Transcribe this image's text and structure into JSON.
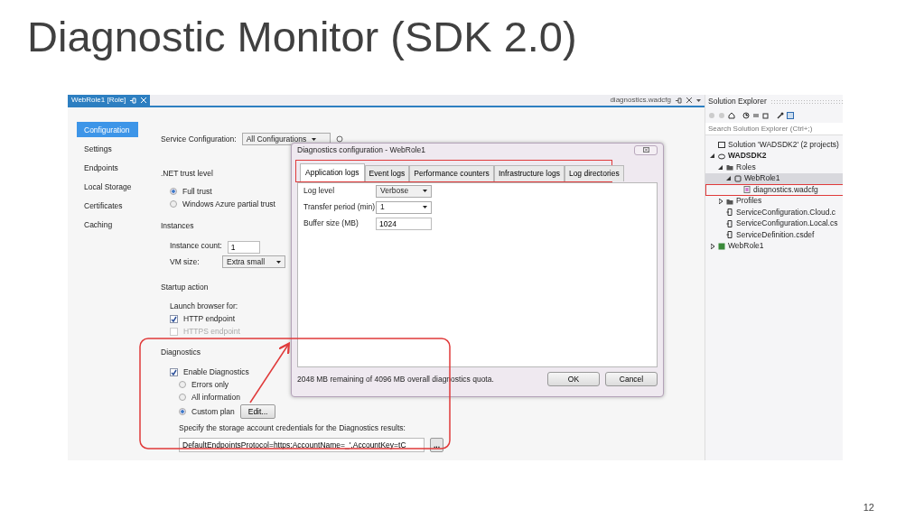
{
  "slide": {
    "title": "Diagnostic Monitor (SDK 2.0)",
    "page_number": "12"
  },
  "document_tabs": [
    {
      "label": "WebRole1 [Role]",
      "selected": true
    },
    {
      "label": "diagnostics.wadcfg",
      "selected": false
    }
  ],
  "role_nav": [
    {
      "label": "Configuration",
      "selected": true
    },
    {
      "label": "Settings",
      "selected": false
    },
    {
      "label": "Endpoints",
      "selected": false
    },
    {
      "label": "Local Storage",
      "selected": false
    },
    {
      "label": "Certificates",
      "selected": false
    },
    {
      "label": "Caching",
      "selected": false
    }
  ],
  "settings": {
    "service_configuration": {
      "label": "Service Configuration:",
      "value": "All Configurations"
    },
    "trust_level": {
      "heading": ".NET trust level",
      "options": [
        {
          "label": "Full trust",
          "selected": true
        },
        {
          "label": "Windows Azure partial trust",
          "selected": false
        }
      ]
    },
    "instances": {
      "heading": "Instances",
      "instance_count": {
        "label": "Instance count:",
        "value": "1"
      },
      "vm_size": {
        "label": "VM size:",
        "value": "Extra small"
      }
    },
    "startup_action": {
      "heading": "Startup action",
      "launch_label": "Launch browser for:",
      "endpoints": [
        {
          "label": "HTTP endpoint",
          "checked": true,
          "disabled": false
        },
        {
          "label": "HTTPS endpoint",
          "checked": false,
          "disabled": true
        }
      ]
    },
    "diagnostics": {
      "heading": "Diagnostics",
      "enable": {
        "label": "Enable Diagnostics",
        "checked": true
      },
      "plans": [
        {
          "label": "Errors only",
          "selected": false
        },
        {
          "label": "All information",
          "selected": false
        },
        {
          "label": "Custom plan",
          "selected": true
        }
      ],
      "edit_button": "Edit...",
      "credentials_label": "Specify the storage account credentials for the Diagnostics results:",
      "connection_string": "DefaultEndpointsProtocol=https;AccountName=_',AccountKey=tC",
      "browse_button": "..."
    }
  },
  "dialog": {
    "title": "Diagnostics configuration - WebRole1",
    "tabs": [
      {
        "label": "Application logs",
        "selected": true
      },
      {
        "label": "Event logs",
        "selected": false
      },
      {
        "label": "Performance counters",
        "selected": false
      },
      {
        "label": "Infrastructure logs",
        "selected": false
      },
      {
        "label": "Log directories",
        "selected": false
      }
    ],
    "fields": [
      {
        "kind": "dropdown",
        "label": "Log level",
        "value": "Verbose"
      },
      {
        "kind": "dropdown",
        "label": "Transfer period (min)",
        "value": "1"
      },
      {
        "kind": "text",
        "label": "Buffer size (MB)",
        "value": "1024"
      }
    ],
    "quota_text": "2048 MB remaining of 4096 MB overall diagnostics quota.",
    "buttons": [
      "OK",
      "Cancel"
    ]
  },
  "solution_explorer": {
    "title": "Solution Explorer",
    "search_placeholder": "Search Solution Explorer (Ctrl+;)",
    "tree": [
      {
        "label": "Solution 'WADSDK2' (2 projects)",
        "kind": "solution",
        "bold": false,
        "selected": false,
        "children": [
          {
            "label": "WADSDK2",
            "kind": "cloud",
            "expanded": true,
            "bold": true,
            "selected": false,
            "children": [
              {
                "label": "Roles",
                "kind": "folder",
                "expanded": true,
                "bold": false,
                "selected": false,
                "children": [
                  {
                    "label": "WebRole1",
                    "kind": "role",
                    "expanded": true,
                    "bold": false,
                    "selected": true,
                    "children": [
                      {
                        "label": "diagnostics.wadcfg",
                        "kind": "config",
                        "bold": false,
                        "selected": false,
                        "annotated": true
                      }
                    ]
                  }
                ]
              },
              {
                "label": "Profiles",
                "kind": "folder",
                "expanded": false,
                "bold": false,
                "selected": false
              },
              {
                "label": "ServiceConfiguration.Cloud.c",
                "kind": "file",
                "bold": false,
                "selected": false
              },
              {
                "label": "ServiceConfiguration.Local.cs",
                "kind": "file",
                "bold": false,
                "selected": false
              },
              {
                "label": "ServiceDefinition.csdef",
                "kind": "file",
                "bold": false,
                "selected": false
              }
            ]
          },
          {
            "label": "WebRole1",
            "kind": "project",
            "expanded": false,
            "bold": false,
            "selected": false
          }
        ]
      }
    ]
  }
}
